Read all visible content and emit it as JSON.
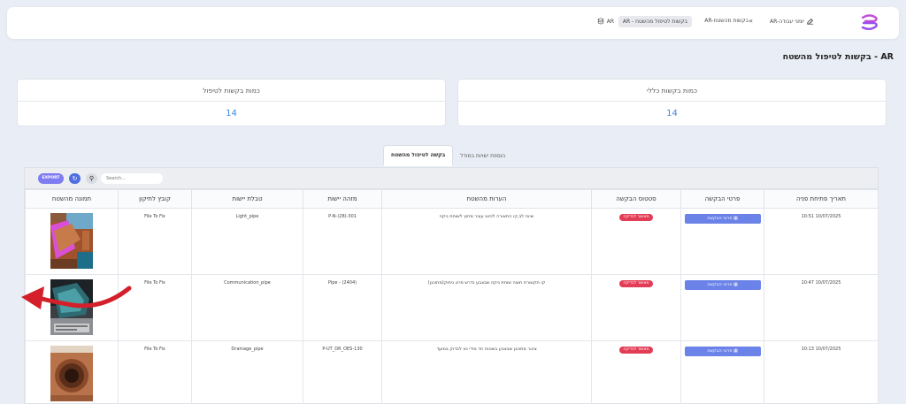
{
  "header": {
    "breadcrumb": {
      "work_orders": "AR-יומני עבודה",
      "requests": "AR-בקשות מהשטח",
      "active": "AR - בקשות לטיפול מהשטח",
      "ar": "AR",
      "separator": "«"
    }
  },
  "page": {
    "title": "AR - בקשות לטיפול מהשטח"
  },
  "stats": [
    {
      "title": "כמות בקשות לטיפול",
      "value": "14"
    },
    {
      "title": "כמות בקשות כללי",
      "value": "14"
    }
  ],
  "tabs": [
    {
      "label": "הוספת ישויות במודל"
    },
    {
      "label": "בקשה לטיפול מהשטח"
    }
  ],
  "toolbar": {
    "export_label": "EXPORT",
    "search_placeholder": "Search..."
  },
  "table": {
    "headers": [
      "תמונה מהשטח",
      "קובץ לתיקון",
      "טבלת יישות",
      "מזהה יישות",
      "הערות מהשטח",
      "סטטוס הבקשה",
      "פרטי הבקשה",
      "תאריך פתיחת פניה"
    ],
    "rows": [
      {
        "file": "File To Fix",
        "entity_table": "Light_pipe",
        "entity_id": "P-N-(28)-301",
        "notes": "שיוח לב,קו התאורה לכיוונ עובר מחוץ לשוחת ניקוז",
        "status": "מאושר לבדיקה",
        "details": "פרטי הבקשה",
        "date": "10:51 10/07/2025"
      },
      {
        "file": "File To Fix",
        "entity_table": "Communication_pipe",
        "entity_id": "Pipe - (2404)",
        "notes": "קו תקשורת חוצה שוחת ניקוז שבצבע נדרש פרט ניתוק(מתוכנן)",
        "status": "מאושר לבדיקה",
        "details": "פרטי הבקשה",
        "date": "10:47 10/07/2025"
      },
      {
        "file": "File To Fix",
        "entity_table": "Drainage_pipe",
        "entity_id": "P-UT_DR_OES-130",
        "notes": "צינור מתוכנן שבצבע בשטוח חד מידי נא לבדוק במועד",
        "status": "מאושר לבדיקה",
        "details": "פרטי הבקשה",
        "date": "10:13 10/07/2025"
      }
    ]
  },
  "colors": {
    "accent": "#6b82e8",
    "status": "#e23d56",
    "value": "#3a8ae0",
    "export": "#7f7cf2",
    "arrow": "#d3202a"
  },
  "icons": {
    "edit": "edit-icon",
    "database": "database-icon",
    "search": "search-icon",
    "refresh": "refresh-icon",
    "list": "list-icon"
  }
}
